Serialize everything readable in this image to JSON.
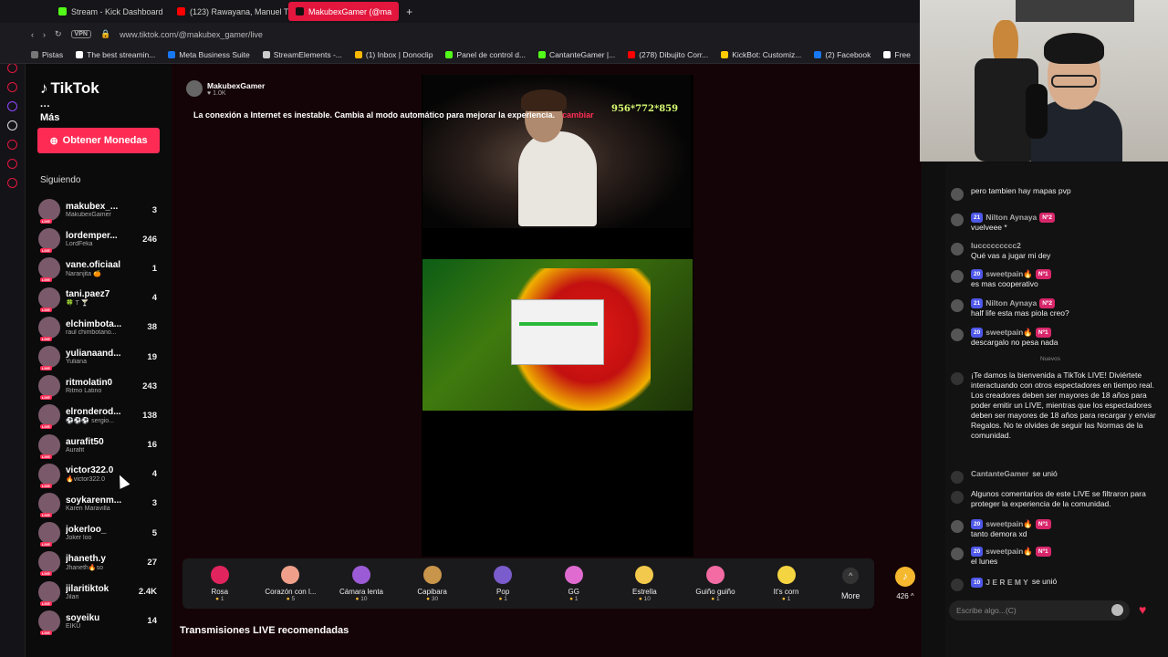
{
  "browser": {
    "tabs": [
      {
        "label": "Stream - Kick Dashboard",
        "color": "#53fc18"
      },
      {
        "label": "(123) Rawayana, Manuel T",
        "color": "#ff0000"
      },
      {
        "label": "MakubexGamer (@ma",
        "color": "#fe2c55"
      }
    ],
    "url": "www.tiktok.com/@makubex_gamer/live",
    "vpn": "VPN",
    "bookmarks": [
      {
        "label": "Pistas",
        "color": "#777777"
      },
      {
        "label": "The best streamin...",
        "color": "#ffffff"
      },
      {
        "label": "Meta Business Suite",
        "color": "#1877f2"
      },
      {
        "label": "StreamElements -...",
        "color": "#cccccc"
      },
      {
        "label": "(1) Inbox | Donoclip",
        "color": "#ffb800"
      },
      {
        "label": "Panel de control d...",
        "color": "#53fc18"
      },
      {
        "label": "CantanteGamer |...",
        "color": "#53fc18"
      },
      {
        "label": "(278) Dibujito Corr...",
        "color": "#ff0000"
      },
      {
        "label": "KickBot: Customiz...",
        "color": "#ffcc00"
      },
      {
        "label": "(2) Facebook",
        "color": "#1877f2"
      },
      {
        "label": "Free",
        "color": "#ffffff"
      }
    ]
  },
  "sidebar": {
    "logo": "TikTok",
    "mas": "Más",
    "coins_button": "Obtener Monedas",
    "following_title": "Siguiendo",
    "following": [
      {
        "name": "makubex_...",
        "sub": "MakubexGamer",
        "count": "3"
      },
      {
        "name": "lordemper...",
        "sub": "LordFeka",
        "count": "246"
      },
      {
        "name": "vane.oficiaal",
        "sub": "Naranjita 🍊",
        "count": "1"
      },
      {
        "name": "tani.paez7",
        "sub": "🍀 T 🍸",
        "count": "4"
      },
      {
        "name": "elchimbota...",
        "sub": "raul chimbotano...",
        "count": "38"
      },
      {
        "name": "yulianaand...",
        "sub": "Yuliana",
        "count": "19"
      },
      {
        "name": "ritmolatin0",
        "sub": "Ritmo Latino",
        "count": "243"
      },
      {
        "name": "elronderod...",
        "sub": "⚽⚽⚽ sergio...",
        "count": "138"
      },
      {
        "name": "aurafit50",
        "sub": "Aurafit",
        "count": "16"
      },
      {
        "name": "victor322.0",
        "sub": "🔥victor322.0",
        "count": "4"
      },
      {
        "name": "soykarenm...",
        "sub": "Karen Maravilla",
        "count": "3"
      },
      {
        "name": "jokerloo_",
        "sub": "Joker loo",
        "count": "5"
      },
      {
        "name": "jhaneth.y",
        "sub": "Jhaneth🔥so",
        "count": "27"
      },
      {
        "name": "jilaritiktok",
        "sub": "Jilari",
        "count": "2.4K"
      },
      {
        "name": "soyeiku",
        "sub": "EIKU",
        "count": "14"
      }
    ]
  },
  "stream": {
    "streamer": "MakubexGamer",
    "views": "♥ 1.0K",
    "warning": "La conexión a Internet es inestable. Cambia al modo automático para mejorar la experiencia.",
    "warning_link": "cambiar",
    "overlay_stats": "956*772*859",
    "recommended": "Transmisiones LIVE recomendadas"
  },
  "gifts": [
    {
      "label": "Rosa",
      "price": "1",
      "color": "#e0245e"
    },
    {
      "label": "Corazón con l...",
      "price": "5",
      "color": "#f0a08a"
    },
    {
      "label": "Cámara lenta",
      "price": "10",
      "color": "#9c5bd6"
    },
    {
      "label": "Capibara",
      "price": "30",
      "color": "#c9954a"
    },
    {
      "label": "Pop",
      "price": "1",
      "color": "#7a5ccc"
    },
    {
      "label": "GG",
      "price": "1",
      "color": "#e06bd0"
    },
    {
      "label": "Estrella",
      "price": "10",
      "color": "#f2c94c"
    },
    {
      "label": "Guiño guiño",
      "price": "1",
      "color": "#f36ba2"
    },
    {
      "label": "It's corn",
      "price": "1",
      "color": "#f5d442"
    }
  ],
  "gift_more": "More",
  "coin_balance": "426",
  "chat": {
    "messages": [
      {
        "user": "",
        "text": "pero tambien hay mapas pvp"
      },
      {
        "user": "Nilton Aynaya",
        "level": "21",
        "fan": "Nº2",
        "text": "vuelveee *"
      },
      {
        "user": "luccccccccc2",
        "text": "Qué vas a jugar mi dey"
      },
      {
        "user": "sweetpain🔥",
        "level": "20",
        "fan": "Nº1",
        "text": "es mas cooperativo"
      },
      {
        "user": "Nilton Aynaya",
        "level": "21",
        "fan": "Nº2",
        "text": "half life esta mas piola creo?"
      },
      {
        "user": "sweetpain🔥",
        "level": "20",
        "fan": "Nº1",
        "text": "descargalo no pesa nada"
      }
    ],
    "divider": "Nuevos",
    "welcome": "¡Te damos la bienvenida a TikTok LIVE! Diviértete interactuando con otros espectadores en tiempo real. Los creadores deben ser mayores de 18 años para poder emitir un LIVE, mientras que los espectadores deben ser mayores de 18 años para recargar y enviar Regalos. No te olvides de seguir las Normas de la comunidad.",
    "join1_user": "CantanteGamer",
    "join_label": "se unió",
    "filter_notice": "Algunos comentarios de este LIVE se filtraron para proteger la experiencia de la comunidad.",
    "messages2": [
      {
        "user": "sweetpain🔥",
        "level": "20",
        "fan": "Nº1",
        "text": "tanto demora xd"
      },
      {
        "user": "sweetpain🔥",
        "level": "20",
        "fan": "Nº1",
        "text": "el lunes"
      }
    ],
    "join2_user": "J E R E M Y",
    "join2_level": "10",
    "input_placeholder": "Escribe algo...(C)"
  }
}
